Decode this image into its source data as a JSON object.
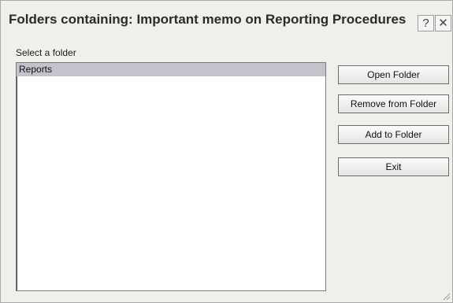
{
  "dialog": {
    "title": "Folders containing: Important memo on Reporting Procedures",
    "help_label": "?",
    "close_label": "✕"
  },
  "folder_list": {
    "label": "Select a folder",
    "items": [
      {
        "label": "Reports",
        "selected": true
      }
    ]
  },
  "buttons": {
    "open_folder": "Open Folder",
    "remove_from_folder": "Remove from Folder",
    "add_to_folder": "Add to Folder",
    "exit": "Exit"
  },
  "colors": {
    "dialog_bg": "#f1efe9",
    "selection_bg": "#c4c3cb"
  },
  "icons": {
    "help": "help-icon",
    "close": "close-icon",
    "resize": "resize-grip-icon"
  }
}
